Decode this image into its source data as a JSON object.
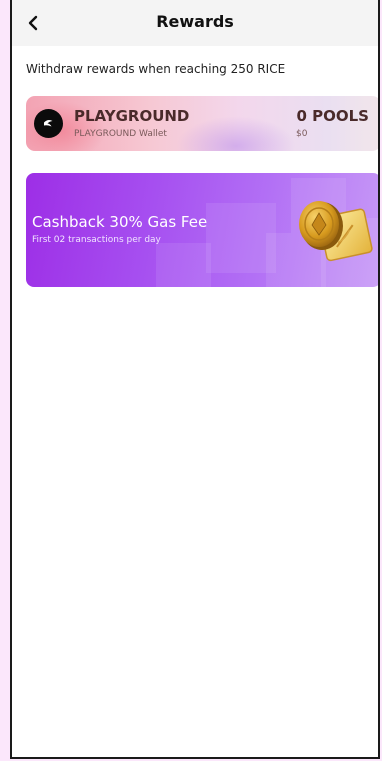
{
  "header": {
    "title": "Rewards",
    "back_icon": "chevron-left-icon"
  },
  "subtitle": "Withdraw rewards when reaching 250 RICE",
  "playground_card": {
    "name": "PLAYGROUND",
    "wallet_label": "PLAYGROUND Wallet",
    "pools": "0 POOLS",
    "amount": "$0",
    "logo_icon": "playground-logo-icon"
  },
  "cashback_card": {
    "title": "Cashback 30% Gas Fee",
    "subtitle": "First 02 transactions per day",
    "art_icon": "gold-coin-ticket-icon"
  },
  "colors": {
    "header_bg": "#f4f4f4",
    "cashback_gradient_start": "#9d2ee6",
    "cashback_gradient_end": "#c79af7",
    "playground_gradient_start": "#f3a3b3",
    "playground_gradient_end": "#f2e6ea"
  }
}
